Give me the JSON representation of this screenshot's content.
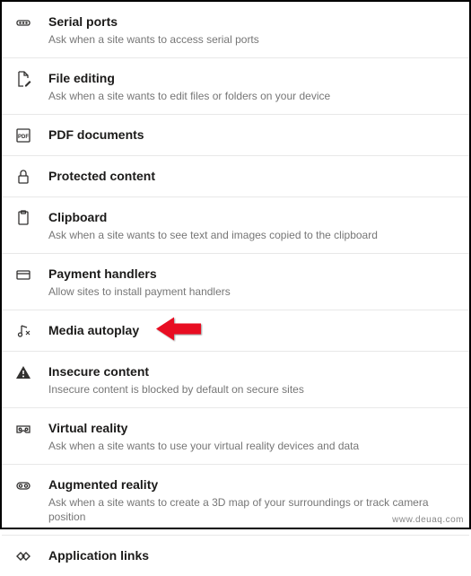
{
  "items": [
    {
      "icon": "serial-port-icon",
      "title": "Serial ports",
      "desc": "Ask when a site wants to access serial ports"
    },
    {
      "icon": "file-edit-icon",
      "title": "File editing",
      "desc": "Ask when a site wants to edit files or folders on your device"
    },
    {
      "icon": "pdf-icon",
      "title": "PDF documents",
      "desc": ""
    },
    {
      "icon": "lock-icon",
      "title": "Protected content",
      "desc": ""
    },
    {
      "icon": "clipboard-icon",
      "title": "Clipboard",
      "desc": "Ask when a site wants to see text and images copied to the clipboard"
    },
    {
      "icon": "payment-icon",
      "title": "Payment handlers",
      "desc": "Allow sites to install payment handlers"
    },
    {
      "icon": "media-icon",
      "title": "Media autoplay",
      "desc": "",
      "highlight": true
    },
    {
      "icon": "warning-icon",
      "title": "Insecure content",
      "desc": "Insecure content is blocked by default on secure sites"
    },
    {
      "icon": "vr-icon",
      "title": "Virtual reality",
      "desc": "Ask when a site wants to use your virtual reality devices and data"
    },
    {
      "icon": "ar-icon",
      "title": "Augmented reality",
      "desc": "Ask when a site wants to create a 3D map of your surroundings or track camera position"
    },
    {
      "icon": "link-icon",
      "title": "Application links",
      "desc": ""
    }
  ],
  "watermark": "www.deuaq.com"
}
